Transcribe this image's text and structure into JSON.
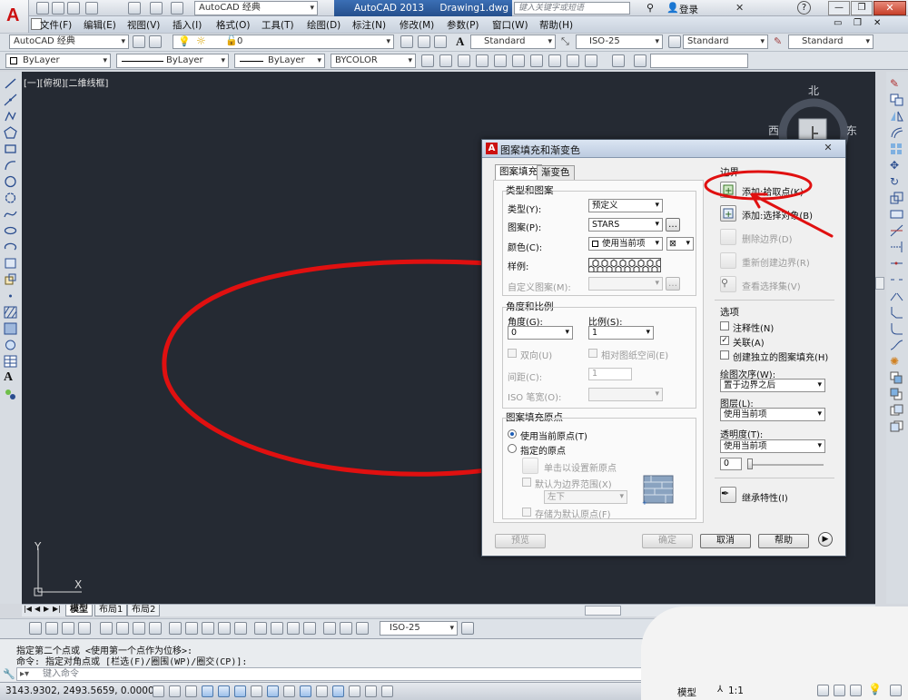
{
  "titlebar": {
    "workspace": "AutoCAD 经典",
    "app_title": "AutoCAD 2013",
    "doc_title": "Drawing1.dwg",
    "search_placeholder": "键入关键字或短语",
    "login": "登录"
  },
  "menu": [
    "文件(F)",
    "编辑(E)",
    "视图(V)",
    "插入(I)",
    "格式(O)",
    "工具(T)",
    "绘图(D)",
    "标注(N)",
    "修改(M)",
    "参数(P)",
    "窗口(W)",
    "帮助(H)"
  ],
  "toolbar1": {
    "workspace_combo": "AutoCAD 经典",
    "layer_combo": "0",
    "text_style": "Standard",
    "dim_style": "ISO-25",
    "table_style": "Standard",
    "mleader_style": "Standard"
  },
  "toolbar2": {
    "color": "ByLayer",
    "linetype": "ByLayer",
    "lineweight": "ByLayer",
    "plotstyle": "BYCOLOR"
  },
  "viewport": {
    "label": "[一][俯视][二维线框]",
    "compass_n": "北",
    "compass_w": "西",
    "compass_e": "东",
    "axis_x": "X",
    "axis_y": "Y"
  },
  "layout_tabs": [
    "模型",
    "布局1",
    "布局2"
  ],
  "dimbar": {
    "dim_style": "ISO-25"
  },
  "command": {
    "line1": "指定第二个点或 <使用第一个点作为位移>:",
    "line2": "命令: 指定对角点或 [栏选(F)/圈围(WP)/圈交(CP)]:",
    "placeholder": "键入命令"
  },
  "status": {
    "coords": "3143.9302, 2493.5659, 0.0000",
    "model": "模型",
    "scale": "1:1"
  },
  "dialog": {
    "title": "图案填充和渐变色",
    "tabs": [
      "图案填充",
      "渐变色"
    ],
    "type_and_pattern": {
      "title": "类型和图案",
      "type_label": "类型(Y):",
      "type_value": "预定义",
      "pattern_label": "图案(P):",
      "pattern_value": "STARS",
      "color_label": "颜色(C):",
      "color_value": "使用当前项",
      "swatch_label": "样例:",
      "custom_label": "自定义图案(M):"
    },
    "angle_scale": {
      "title": "角度和比例",
      "angle_label": "角度(G):",
      "angle_value": "0",
      "scale_label": "比例(S):",
      "scale_value": "1",
      "double_label": "双向(U)",
      "relative_label": "相对图纸空间(E)",
      "spacing_label": "间距(C):",
      "spacing_value": "1",
      "iso_label": "ISO 笔宽(O):"
    },
    "origin": {
      "title": "图案填充原点",
      "use_current": "使用当前原点(T)",
      "specified": "指定的原点",
      "click_set": "单击以设置新原点",
      "default_extent": "默认为边界范围(X)",
      "extent_value": "左下",
      "store_default": "存储为默认原点(F)"
    },
    "boundary": {
      "title": "边界",
      "add_pick": "添加:拾取点(K)",
      "add_select": "添加:选择对象(B)",
      "remove": "删除边界(D)",
      "recreate": "重新创建边界(R)",
      "view_sel": "查看选择集(V)"
    },
    "options": {
      "title": "选项",
      "annotative": "注释性(N)",
      "associative": "关联(A)",
      "separate": "创建独立的图案填充(H)",
      "draw_order_label": "绘图次序(W):",
      "draw_order_value": "置于边界之后",
      "layer_label": "图层(L):",
      "layer_value": "使用当前项",
      "transparency_label": "透明度(T):",
      "transparency_value": "使用当前项",
      "transparency_number": "0"
    },
    "inherit": "继承特性(I)",
    "buttons": {
      "preview": "预览",
      "ok": "确定",
      "cancel": "取消",
      "help": "帮助"
    }
  }
}
